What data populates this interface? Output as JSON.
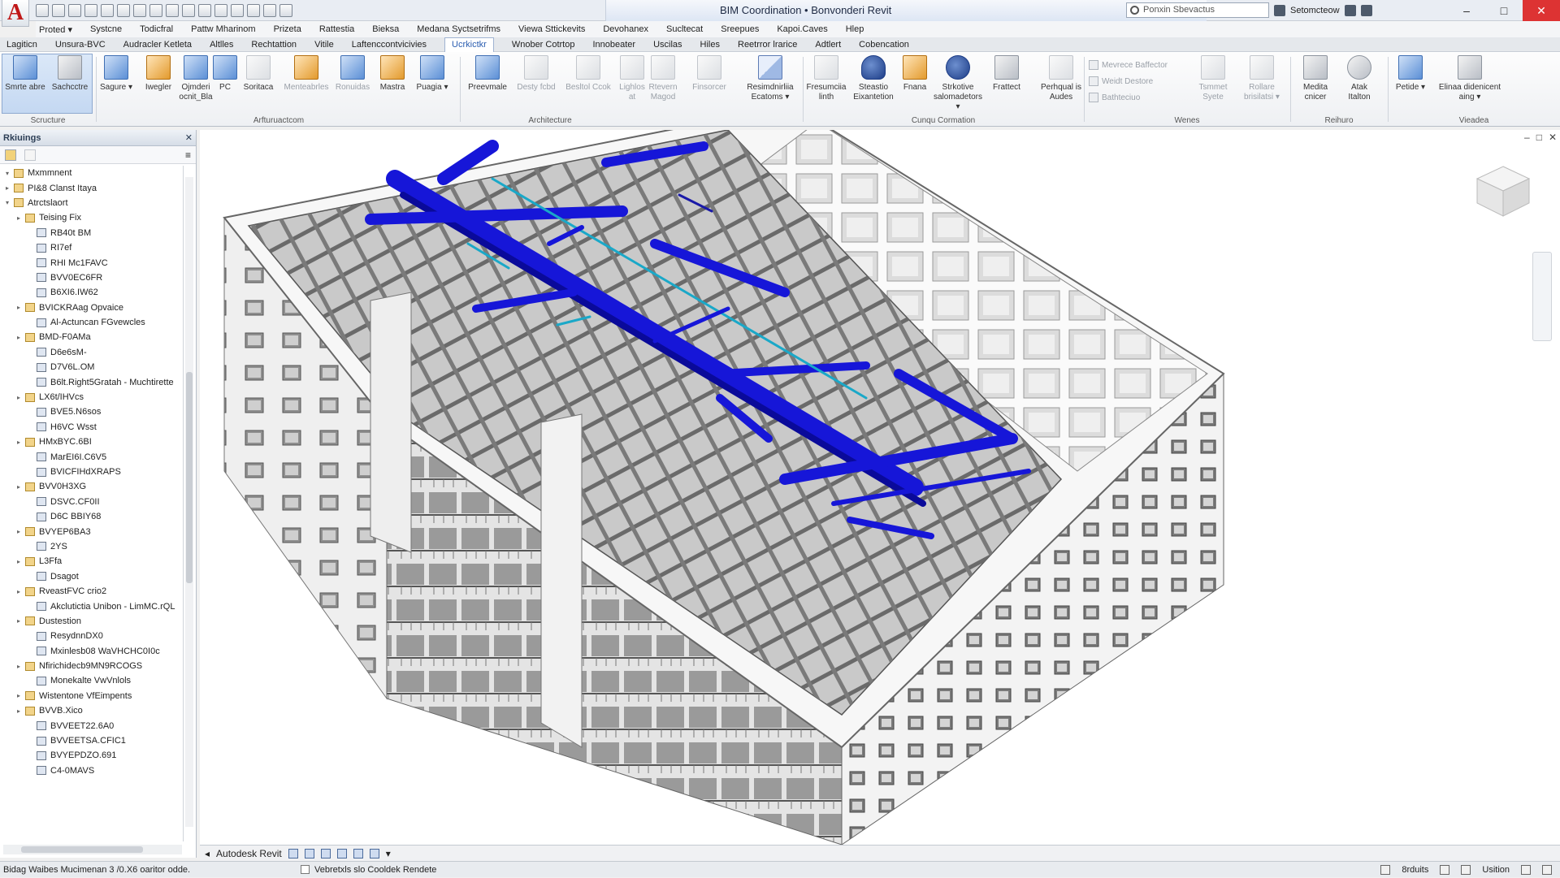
{
  "window": {
    "title": "BIM Coordination • Bonvonderi Revit",
    "search_placeholder": "Ponxin Sbevactus",
    "signin_label": "Setomcteow",
    "minimize": "–",
    "maximize": "□",
    "close": "✕"
  },
  "menu": [
    "Proted ▾",
    "Systcne",
    "Todicfral",
    "Pattw Mharinom",
    "Prizeta",
    "Rattestia",
    "Bieksa",
    "Medana Syctsetrifms",
    "Viewa Sttickevits",
    "Devohanex",
    "Sucltecat",
    "Sreepues",
    "Kapoi.Caves",
    "Hlep"
  ],
  "tabs": [
    "Lagiticn",
    "Unsura-BVC",
    "Audracler Ketleta",
    "Altlles",
    "Rechtattion",
    "Vitile",
    "Laftenccontvicivies",
    "Ucrkictkr",
    "Wnober Cotrtop",
    "Innobeater",
    "Uscilas",
    "Hiles",
    "Reetrror lrarice",
    "Adtlert",
    "Cobencation"
  ],
  "active_tab": "Ucrkictkr",
  "ribbon": {
    "modify": [
      "Smrte abre",
      "Sachcctre"
    ],
    "buttons": [
      {
        "label": "Sagure ▾",
        "icon": "door-icon"
      },
      {
        "label": "Iwegler",
        "icon": "window-icon"
      },
      {
        "label": "Ojmderi ocnit_Bla",
        "icon": "component-icon"
      },
      {
        "label": "PC",
        "icon": "column-icon"
      },
      {
        "label": "Soritaca",
        "icon": "roof-icon"
      },
      {
        "label": "Menteabrles",
        "icon": "ceiling-icon"
      },
      {
        "label": "Ronuidas",
        "icon": "floor-icon"
      },
      {
        "label": "Mastra",
        "icon": "curtain-icon"
      },
      {
        "label": "Puagia ▾",
        "icon": "railing-icon"
      },
      {
        "label": "Preevmale",
        "icon": "ramp-icon"
      },
      {
        "label": "Desty fcbd",
        "icon": "stair-icon"
      },
      {
        "label": "Besltol Ccok",
        "icon": "model-text-icon"
      },
      {
        "label": "Lighlos at",
        "icon": "model-line-icon"
      },
      {
        "label": "Rtevern Magod",
        "icon": "model-group-icon"
      },
      {
        "label": "Finsorcer",
        "icon": "room-icon"
      },
      {
        "label": "Resimdnirliia Ecatoms ▾",
        "icon": "area-icon"
      },
      {
        "label": "Fresumciia linth",
        "icon": "tag-icon"
      },
      {
        "label": "Steastio Eixantetion",
        "icon": "opening-icon"
      },
      {
        "label": "Fnana",
        "icon": "shaft-icon"
      },
      {
        "label": "Strkotive salomadetors ▾",
        "icon": "comment-icon"
      },
      {
        "label": "Frattect",
        "icon": "datum-icon"
      },
      {
        "label": "Perhqual is Audes",
        "icon": "grid-icon"
      },
      {
        "label": "Tsmmet Syete",
        "icon": "set-icon"
      },
      {
        "label": "Rollare brisilatsi ▾",
        "icon": "show-icon"
      },
      {
        "label": "Medita cnicer",
        "icon": "viewer-icon"
      },
      {
        "label": "Atak Italton",
        "icon": "ref-plane-icon"
      },
      {
        "label": "Petide ▾",
        "icon": "section-icon"
      },
      {
        "label": "Elinaa didenicent aing ▾",
        "icon": "elevation-icon"
      }
    ],
    "small_items": [
      "Mevrece Baffector",
      "Weidt Destore",
      "Bathteciuo"
    ],
    "groups": [
      "Scructure",
      "Arfturuactcom",
      "Architecture",
      "Cunqu Cormation",
      "Wenes",
      "Reihuro",
      "Vieadea"
    ]
  },
  "browser": {
    "title": "Rkiuings",
    "close": "✕",
    "items": [
      {
        "label": "Mxmmnent",
        "exp": "▾",
        "indent": 1
      },
      {
        "label": "PI&8 Clanst Itaya",
        "exp": "▸",
        "indent": 1
      },
      {
        "label": "Atrctslaort",
        "exp": "▾",
        "indent": 1
      },
      {
        "label": "Teising Fix",
        "exp": "▸",
        "indent": 2
      },
      {
        "label": "RB40t BM",
        "exp": "",
        "indent": 3
      },
      {
        "label": "RI7ef",
        "exp": "",
        "indent": 3
      },
      {
        "label": "RHI Mc1FAVC",
        "exp": "",
        "indent": 3
      },
      {
        "label": "BVV0EC6FR",
        "exp": "",
        "indent": 3
      },
      {
        "label": "B6XI6.IW62",
        "exp": "",
        "indent": 3
      },
      {
        "label": "BVICKRAag Opvaice",
        "exp": "▸",
        "indent": 2
      },
      {
        "label": "Al-Actuncan FGvewcles",
        "exp": "",
        "indent": 3
      },
      {
        "label": "BMD-F0AMa",
        "exp": "▸",
        "indent": 2
      },
      {
        "label": "D6e6sM-",
        "exp": "",
        "indent": 3
      },
      {
        "label": "D7V6L.OM",
        "exp": "",
        "indent": 3
      },
      {
        "label": "B6lt.Right5Gratah - Muchtirette",
        "exp": "",
        "indent": 3
      },
      {
        "label": "LX6t/IHVcs",
        "exp": "▸",
        "indent": 2
      },
      {
        "label": "BVE5.N6sos",
        "exp": "",
        "indent": 3
      },
      {
        "label": "H6VC Wsst",
        "exp": "",
        "indent": 3
      },
      {
        "label": "HMxBYC.6BI",
        "exp": "▸",
        "indent": 2
      },
      {
        "label": "MarEI6I.C6V5",
        "exp": "",
        "indent": 3
      },
      {
        "label": "BVICFIHdXRAPS",
        "exp": "",
        "indent": 3
      },
      {
        "label": "BVV0H3XG",
        "exp": "▸",
        "indent": 2
      },
      {
        "label": "DSVC.CF0II",
        "exp": "",
        "indent": 3
      },
      {
        "label": "D6C BBIY68",
        "exp": "",
        "indent": 3
      },
      {
        "label": "BVYEP6BA3",
        "exp": "▸",
        "indent": 2
      },
      {
        "label": "2YS",
        "exp": "",
        "indent": 3
      },
      {
        "label": "L3Ffa",
        "exp": "▸",
        "indent": 2
      },
      {
        "label": "Dsagot",
        "exp": "",
        "indent": 3
      },
      {
        "label": "RveastFVC crio2",
        "exp": "▸",
        "indent": 2
      },
      {
        "label": "Akclutictia Unibon - LimMC.rQL",
        "exp": "",
        "indent": 3
      },
      {
        "label": "Dustestion",
        "exp": "▸",
        "indent": 2
      },
      {
        "label": "ResydnnDX0",
        "exp": "",
        "indent": 3
      },
      {
        "label": "Mxinlesb08 WaVHCHC0I0c",
        "exp": "",
        "indent": 3
      },
      {
        "label": "Nfirichidecb9MN9RCOGS",
        "exp": "▸",
        "indent": 2
      },
      {
        "label": "Monekalte VwVnlols",
        "exp": "",
        "indent": 3
      },
      {
        "label": "Wistentone VfEimpents",
        "exp": "▸",
        "indent": 2
      },
      {
        "label": "BVVB.Xico",
        "exp": "▸",
        "indent": 2
      },
      {
        "label": "BVVEET22.6A0",
        "exp": "",
        "indent": 3
      },
      {
        "label": "BVVEETSA.CFIC1",
        "exp": "",
        "indent": 3
      },
      {
        "label": "BVYEPDZO.691",
        "exp": "",
        "indent": 3
      },
      {
        "label": "C4-0MAVS",
        "exp": "",
        "indent": 3
      }
    ]
  },
  "viewport": {
    "controls": [
      "–",
      "□",
      "✕"
    ],
    "colors": {
      "ducts": "#1616d8",
      "pipes": "#1aa8c8",
      "structure": "#6c6c6c",
      "walls": "#f4f4f4"
    }
  },
  "viewbar": {
    "label": "Autodesk Revit"
  },
  "status": {
    "left": "Bidag Waibes Mucimenan 3 /0.X6 oaritor odde.",
    "checkbox_label": "Vebretxls slo Cooldek Rendete",
    "right_items": [
      "8rduits",
      "Usition"
    ]
  }
}
